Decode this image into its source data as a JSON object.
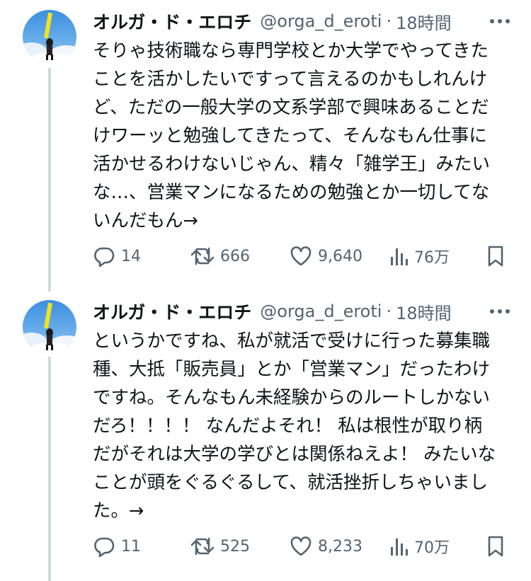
{
  "tweets": [
    {
      "name": "オルガ・ド・エロチ",
      "handle": "@orga_d_eroti",
      "separator": "·",
      "time": "18時間",
      "lines": [
        "そりゃ技術職なら専門学校とか大学でやってきた",
        "ことを活かしたいですって言えるのかもしれんけ",
        "ど、ただの一般大学の文系学部で興味あることだ",
        "けワーッと勉強してきたって、そんなもん仕事に",
        "活かせるわけないじゃん、精々「雑学王」みたい",
        "な…、営業マンになるための勉強とか一切してな",
        "いんだもん→"
      ],
      "replies": "14",
      "reposts": "666",
      "likes": "9,640",
      "views": "76万"
    },
    {
      "name": "オルガ・ド・エロチ",
      "handle": "@orga_d_eroti",
      "separator": "·",
      "time": "18時間",
      "lines": [
        "というかですね、私が就活で受けに行った募集職",
        "種、大抵「販売員」とか「営業マン」だったわけ",
        "ですね。そんなもん未経験からのルートしかない",
        "だろ！！！！ なんだよそれ！ 私は根性が取り柄",
        "だがそれは大学の学びとは関係ねえよ！ みたいな",
        "ことが頭をぐるぐるして、就活挫折しちゃいまし",
        "た。→"
      ],
      "replies": "11",
      "reposts": "525",
      "likes": "8,233",
      "views": "70万"
    }
  ]
}
